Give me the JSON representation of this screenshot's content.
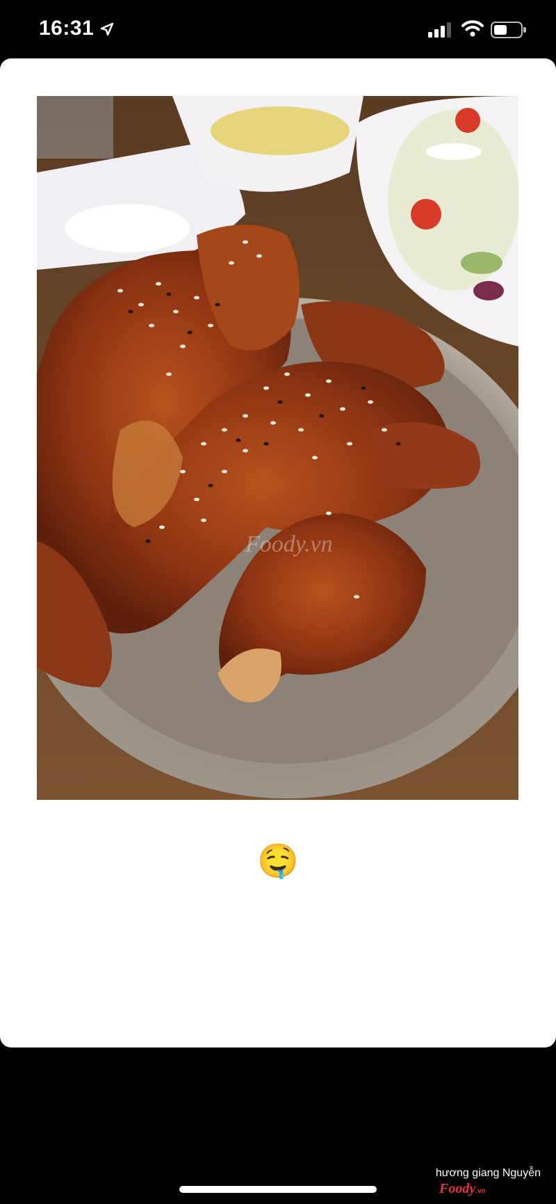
{
  "status_bar": {
    "time": "16:31",
    "icons": [
      "location-arrow-icon",
      "cellular-signal-icon",
      "wifi-icon",
      "battery-icon"
    ]
  },
  "post": {
    "photo": "food photo: fried chicken with glaze and sesame on a plate, side salad and pickled radish",
    "watermark_text": "Foody.vn",
    "caption": "🤤"
  },
  "footer": {
    "author": "hương giang Nguyễn",
    "brand": "Foody",
    "brand_suffix": ".vn"
  },
  "colors": {
    "background": "#000000",
    "card": "#ffffff",
    "brand_red": "#e8343f"
  }
}
